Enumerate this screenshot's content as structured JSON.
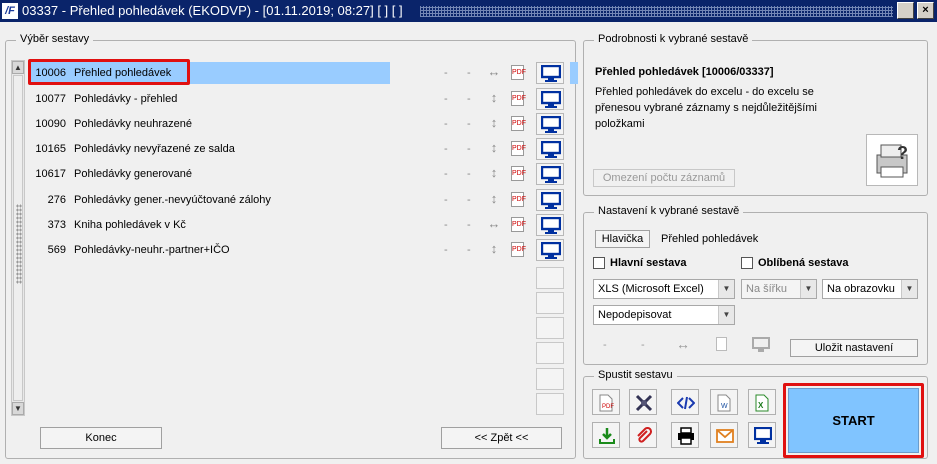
{
  "window": {
    "title": "03337 - Přehled pohledávek (EKODVP) - [01.11.2019; 08:27]  [ ]  [ ]",
    "logo_text": "/F"
  },
  "report_select": {
    "legend": "Výběr sestavy",
    "rows": [
      {
        "num": "10006",
        "name": "Přehled pohledávek",
        "arrow": "↔",
        "selected": true
      },
      {
        "num": "10077",
        "name": "Pohledávky - přehled",
        "arrow": "↕",
        "selected": false
      },
      {
        "num": "10090",
        "name": "Pohledávky neuhrazené",
        "arrow": "↕",
        "selected": false
      },
      {
        "num": "10165",
        "name": "Pohledávky nevyřazené ze salda",
        "arrow": "↕",
        "selected": false
      },
      {
        "num": "10617",
        "name": "Pohledávky generované",
        "arrow": "↕",
        "selected": false
      },
      {
        "num": "276",
        "name": "Pohledávky gener.-nevyúčtované zálohy",
        "arrow": "↕",
        "selected": false
      },
      {
        "num": "373",
        "name": "Kniha pohledávek v Kč",
        "arrow": "↔",
        "selected": false
      },
      {
        "num": "569",
        "name": "Pohledávky-neuhr.-partner+IČO",
        "arrow": "↕",
        "selected": false
      }
    ],
    "dash": "-",
    "pdf_label": "PDF"
  },
  "footer": {
    "konec_label": "Konec",
    "zpet_label": "<< Zpět <<"
  },
  "details": {
    "legend": "Podrobnosti k vybrané sestavě",
    "title": "Přehled pohledávek [10006/03337]",
    "description": "Přehled pohledávek do excelu - do excelu se přenesou vybrané záznamy s nejdůležitějšími položkami",
    "limit_button": "Omezení počtu záznamů"
  },
  "settings": {
    "legend": "Nastavení k vybrané sestavě",
    "header_button": "Hlavička",
    "header_value": "Přehled pohledávek",
    "main_report_label": "Hlavní sestava",
    "favorite_label": "Oblíbená sestava",
    "format_value": "XLS (Microsoft Excel)",
    "orientation_value": "Na šířku",
    "output_value": "Na obrazovku",
    "sign_value": "Nepodepisovat",
    "dash": "-",
    "save_button": "Uložit nastavení"
  },
  "run": {
    "legend": "Spustit sestavu",
    "start_label": "START"
  },
  "colors": {
    "titlebar": "#0a246a",
    "selection": "#99ccff",
    "highlight_box": "#e01010",
    "start_button": "#80c4ff",
    "monitor_icon": "#0030a0"
  }
}
